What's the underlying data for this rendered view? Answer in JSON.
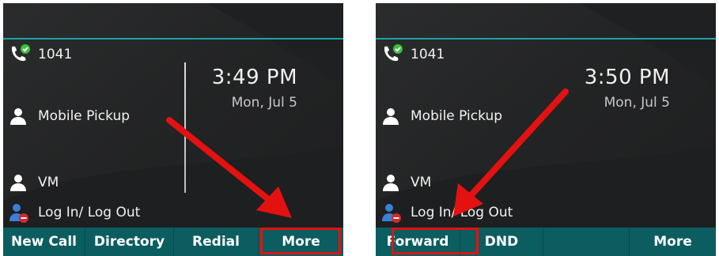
{
  "screens": [
    {
      "lines": [
        {
          "label": "1041",
          "icon": "phone-registered-icon"
        },
        {
          "label": "Mobile Pickup",
          "icon": "contact-icon"
        },
        {
          "label": "VM",
          "icon": "contact-icon"
        },
        {
          "label": "Log In/ Log Out",
          "icon": "user-logout-icon"
        }
      ],
      "clock": {
        "time": "3:49 PM",
        "date": "Mon, Jul 5"
      },
      "softkeys": [
        {
          "label": "New Call"
        },
        {
          "label": "Directory"
        },
        {
          "label": "Redial"
        },
        {
          "label": "More"
        }
      ],
      "highlight": "More"
    },
    {
      "lines": [
        {
          "label": "1041",
          "icon": "phone-registered-icon"
        },
        {
          "label": "Mobile Pickup",
          "icon": "contact-icon"
        },
        {
          "label": "VM",
          "icon": "contact-icon"
        },
        {
          "label": "Log In/ Log Out",
          "icon": "user-logout-icon"
        }
      ],
      "clock": {
        "time": "3:50 PM",
        "date": "Mon, Jul 5"
      },
      "softkeys": [
        {
          "label": "Forward"
        },
        {
          "label": "DND"
        },
        {
          "label": ""
        },
        {
          "label": "More"
        }
      ],
      "highlight": "Forward"
    }
  ],
  "colors": {
    "softkey_bar": "#0b5d60",
    "accent_line": "#1aa3a6",
    "annotation_red": "#e41111",
    "status_green": "#3bbf3b"
  }
}
